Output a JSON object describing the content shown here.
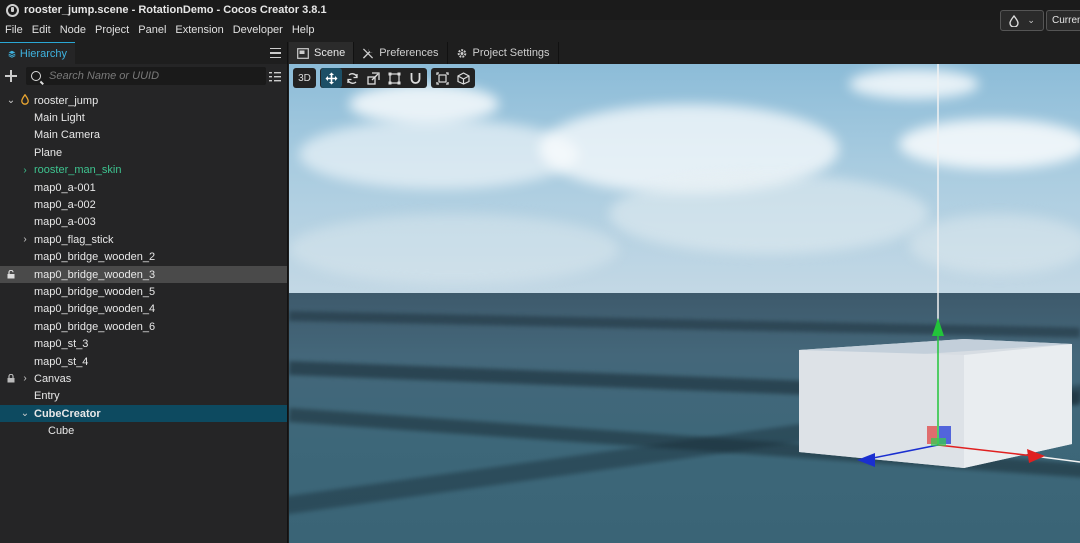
{
  "window": {
    "title": "rooster_jump.scene - RotationDemo - Cocos Creator 3.8.1"
  },
  "titlebar": {
    "current_label": "Current"
  },
  "menu": [
    "File",
    "Edit",
    "Node",
    "Project",
    "Panel",
    "Extension",
    "Developer",
    "Help"
  ],
  "hierarchy": {
    "tab_label": "Hierarchy",
    "search_placeholder": "Search Name or UUID",
    "nodes": [
      {
        "label": "rooster_jump"
      },
      {
        "label": "Main Light"
      },
      {
        "label": "Main Camera"
      },
      {
        "label": "Plane"
      },
      {
        "label": "rooster_man_skin"
      },
      {
        "label": "map0_a-001"
      },
      {
        "label": "map0_a-002"
      },
      {
        "label": "map0_a-003"
      },
      {
        "label": "map0_flag_stick"
      },
      {
        "label": "map0_bridge_wooden_2"
      },
      {
        "label": "map0_bridge_wooden_3"
      },
      {
        "label": "map0_bridge_wooden_5"
      },
      {
        "label": "map0_bridge_wooden_4"
      },
      {
        "label": "map0_bridge_wooden_6"
      },
      {
        "label": "map0_st_3"
      },
      {
        "label": "map0_st_4"
      },
      {
        "label": "Canvas"
      },
      {
        "label": "Entry"
      },
      {
        "label": "CubeCreator"
      },
      {
        "label": "Cube"
      }
    ]
  },
  "tabs": {
    "scene": "Scene",
    "preferences": "Preferences",
    "project_settings": "Project Settings"
  },
  "scene_toolbar": {
    "mode_label": "3D"
  },
  "colors": {
    "accent": "#2aa7d4",
    "prefab_text": "#3ec38f",
    "selected_blue": "#0d4a60",
    "gizmo_x": "#e02020",
    "gizmo_y": "#22c43a",
    "gizmo_z": "#1a2fd0"
  }
}
